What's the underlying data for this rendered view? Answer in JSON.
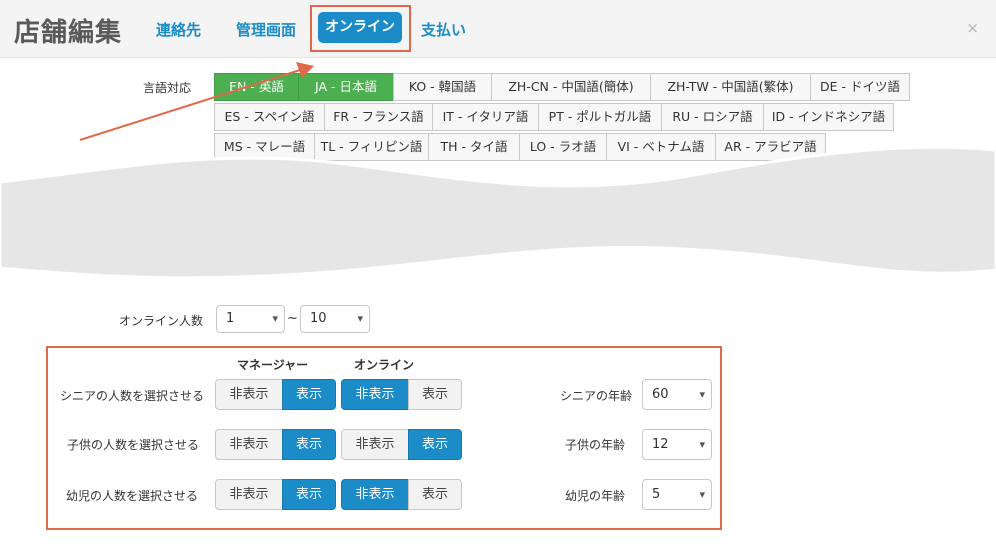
{
  "header": {
    "title": "店舗編集",
    "tabs": [
      "連絡先",
      "管理画面",
      "オンライン",
      "支払い"
    ],
    "active_tab": "オンライン",
    "close_label": "×"
  },
  "language": {
    "label": "言語対応",
    "buttons": [
      "EN - 英語",
      "JA - 日本語",
      "KO - 韓国語",
      "ZH-CN - 中国語(簡体)",
      "ZH-TW - 中国語(繁体)",
      "DE - ドイツ語",
      "ES - スペイン語",
      "FR - フランス語",
      "IT - イタリア語",
      "PT - ポルトガル語",
      "RU - ロシア語",
      "ID - インドネシア語",
      "MS - マレー語",
      "TL - フィリピン語",
      "TH - タイ語",
      "LO - ラオ語",
      "VI - ベトナム語",
      "AR - アラビア語"
    ],
    "selected": [
      "EN - 英語",
      "JA - 日本語"
    ]
  },
  "online_count": {
    "label": "オンライン人数",
    "min": "1",
    "separator": "~",
    "max": "10"
  },
  "columns": {
    "manager": "マネージャー",
    "online": "オンライン"
  },
  "toggle_labels": {
    "hide": "非表示",
    "show": "表示"
  },
  "rows": [
    {
      "label": "シニアの人数を選択させる",
      "manager": "表示",
      "online": "非表示",
      "age_label": "シニアの年齢",
      "age": "60"
    },
    {
      "label": "子供の人数を選択させる",
      "manager": "表示",
      "online": "表示",
      "age_label": "子供の年齢",
      "age": "12"
    },
    {
      "label": "幼児の人数を選択させる",
      "manager": "表示",
      "online": "非表示",
      "age_label": "幼児の年齢",
      "age": "5"
    }
  ],
  "colors": {
    "accent": "#1b8cc8",
    "selected_language": "#4caf50",
    "highlight": "#e0694a"
  },
  "icons": {
    "close": "close-icon",
    "select": "chevron-down-icon"
  }
}
